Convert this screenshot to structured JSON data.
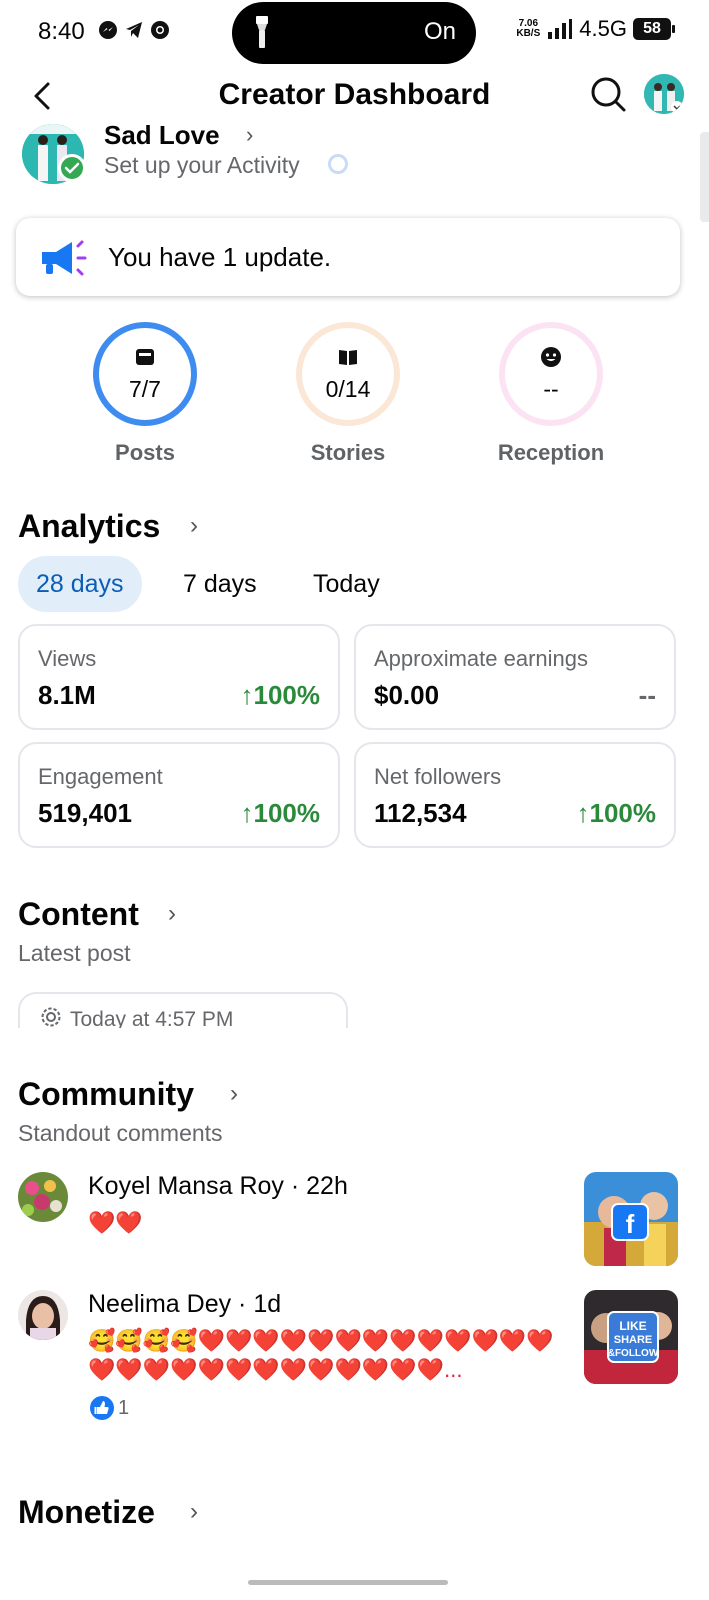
{
  "status_bar": {
    "time": "8:40",
    "flash_state": "On",
    "speed_value": "7.06",
    "speed_unit": "KB/S",
    "network": "4.5G",
    "battery": "58"
  },
  "header": {
    "title": "Creator Dashboard"
  },
  "profile": {
    "name": "Sad Love",
    "subtitle": "Set up your Activity"
  },
  "update_banner": {
    "text": "You have 1 update."
  },
  "rings": [
    {
      "label": "Posts",
      "value": "7/7",
      "icon": "post-icon",
      "color": "#3f8cf0",
      "progress": 1.0
    },
    {
      "label": "Stories",
      "value": "0/14",
      "icon": "book-icon",
      "color": "#fbe7d6",
      "progress": 0.0
    },
    {
      "label": "Reception",
      "value": "--",
      "icon": "smiley-icon",
      "color": "#fbe3f4",
      "progress": 0.0
    }
  ],
  "analytics": {
    "title": "Analytics",
    "tabs": [
      "28 days",
      "7 days",
      "Today"
    ],
    "active_tab": "28 days",
    "stats": [
      {
        "label": "Views",
        "value": "8.1M",
        "change": "↑100%"
      },
      {
        "label": "Approximate earnings",
        "value": "$0.00",
        "change": "--"
      },
      {
        "label": "Engagement",
        "value": "519,401",
        "change": "↑100%"
      },
      {
        "label": "Net followers",
        "value": "112,534",
        "change": "↑100%"
      }
    ]
  },
  "content": {
    "title": "Content",
    "subtitle": "Latest post",
    "latest_post_time": "Today at 4:57 PM"
  },
  "community": {
    "title": "Community",
    "subtitle": "Standout comments",
    "comments": [
      {
        "author_line": "Koyel Mansa Roy · 22h",
        "text": "❤️❤️",
        "likes": ""
      },
      {
        "author_line": "Neelima Dey · 1d",
        "text": "🥰🥰🥰🥰❤️❤️❤️❤️❤️❤️❤️❤️❤️❤️❤️❤️❤️❤️❤️❤️❤️❤️❤️❤️❤️❤️❤️❤️❤️❤️...",
        "likes": "1"
      }
    ]
  },
  "monetize": {
    "title": "Monetize"
  }
}
